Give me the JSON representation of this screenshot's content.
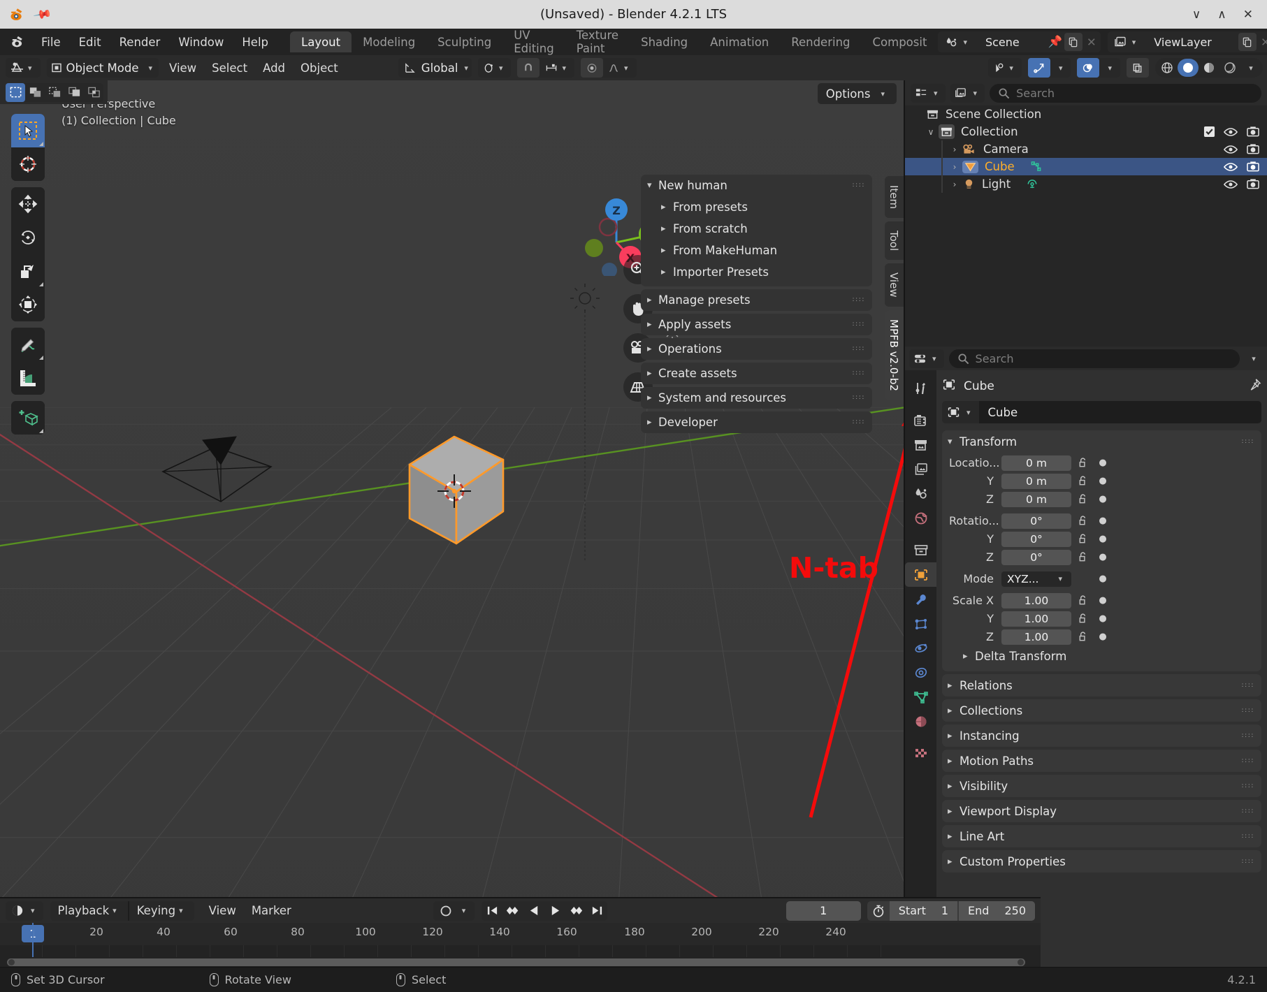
{
  "window": {
    "title": "(Unsaved) - Blender 4.2.1 LTS",
    "minimize": "∨",
    "maximize": "∧",
    "close": "✕"
  },
  "menubar": {
    "items": [
      "File",
      "Edit",
      "Render",
      "Window",
      "Help"
    ],
    "workspace_tabs": [
      {
        "label": "Layout",
        "active": true
      },
      {
        "label": "Modeling",
        "active": false
      },
      {
        "label": "Sculpting",
        "active": false
      },
      {
        "label": "UV Editing",
        "active": false
      },
      {
        "label": "Texture Paint",
        "active": false
      },
      {
        "label": "Shading",
        "active": false
      },
      {
        "label": "Animation",
        "active": false
      },
      {
        "label": "Rendering",
        "active": false
      },
      {
        "label": "Composit",
        "active": false
      }
    ],
    "scene_name": "Scene",
    "viewlayer_name": "ViewLayer"
  },
  "viewport_header": {
    "mode": "Object Mode",
    "menus": [
      "View",
      "Select",
      "Add",
      "Object"
    ],
    "transform_orientation": "Global",
    "options_label": "Options"
  },
  "viewport": {
    "perspective": "User Perspective",
    "scene_info": "(1) Collection | Cube",
    "gizmo_axes": [
      {
        "label": "Z",
        "color": "#3889d8"
      },
      {
        "label": "Y",
        "color": "#7ac01d"
      },
      {
        "label": "X",
        "color": "#fa3d5d"
      }
    ],
    "annotation": {
      "text": "N-tab",
      "color": "#f40b0b"
    },
    "toolbar_icons": [
      "tweak-select-tool",
      "cursor-tool",
      "move-tool",
      "rotate-tool",
      "scale-tool",
      "transform-tool",
      "annotate-tool",
      "measure-tool",
      "add-cube-tool"
    ],
    "nav_icons": [
      "zoom-icon",
      "hand-icon",
      "camera-icon",
      "grid-icon"
    ]
  },
  "npanel": {
    "tabs": [
      {
        "label": "Item",
        "active": false
      },
      {
        "label": "Tool",
        "active": false
      },
      {
        "label": "View",
        "active": false
      },
      {
        "label": "MPFB v2.0-b2",
        "active": true
      }
    ],
    "sections": [
      {
        "label": "New human",
        "expanded": true,
        "children": [
          "From presets",
          "From scratch",
          "From MakeHuman",
          "Importer Presets"
        ]
      },
      {
        "label": "Manage presets",
        "expanded": false,
        "children": []
      },
      {
        "label": "Apply assets",
        "expanded": false,
        "children": []
      },
      {
        "label": "Operations",
        "expanded": false,
        "children": []
      },
      {
        "label": "Create assets",
        "expanded": false,
        "children": []
      },
      {
        "label": "System and resources",
        "expanded": false,
        "children": []
      },
      {
        "label": "Developer",
        "expanded": false,
        "children": []
      }
    ]
  },
  "outliner": {
    "search_placeholder": "Search",
    "rows": [
      {
        "label": "Scene Collection",
        "indent": 0,
        "icon": "collection-icon",
        "expander": "",
        "selected": false,
        "checkbox": false,
        "eye": false,
        "camera": false
      },
      {
        "label": "Collection",
        "indent": 1,
        "icon": "collection-icon",
        "expander": "∨",
        "selected": false,
        "checkbox": true,
        "eye": true,
        "camera": true
      },
      {
        "label": "Camera",
        "indent": 2,
        "icon": "camera-object-icon",
        "expander": "›",
        "selected": false,
        "checkbox": false,
        "eye": true,
        "camera": true
      },
      {
        "label": "Cube",
        "indent": 2,
        "icon": "mesh-object-icon",
        "expander": "›",
        "selected": true,
        "checkbox": false,
        "eye": true,
        "camera": true,
        "data_icon": "mesh-data-icon"
      },
      {
        "label": "Light",
        "indent": 2,
        "icon": "light-object-icon",
        "expander": "›",
        "selected": false,
        "checkbox": false,
        "eye": true,
        "camera": true,
        "data_icon": "light-data-icon"
      }
    ]
  },
  "properties": {
    "search_placeholder": "Search",
    "breadcrumb_object": "Cube",
    "object_name": "Cube",
    "tabs": [
      "tool-icon",
      "render-icon",
      "output-icon",
      "viewlayer-icon",
      "scene-icon",
      "world-icon",
      "collection-icon",
      "object-icon",
      "modifiers-icon",
      "particles-icon",
      "physics-icon",
      "constraints-icon",
      "data-icon",
      "material-icon",
      "texture-icon"
    ],
    "transform": {
      "title": "Transform",
      "location": {
        "label": "Locatio...",
        "x": "0 m",
        "y_label": "Y",
        "y": "0 m",
        "z_label": "Z",
        "z": "0 m"
      },
      "rotation": {
        "label": "Rotatio...",
        "x": "0°",
        "y_label": "Y",
        "y": "0°",
        "z_label": "Z",
        "z": "0°"
      },
      "mode": {
        "label": "Mode",
        "value": "XYZ..."
      },
      "scale": {
        "label": "Scale X",
        "x": "1.00",
        "y_label": "Y",
        "y": "1.00",
        "z_label": "Z",
        "z": "1.00"
      },
      "delta": "Delta Transform"
    },
    "panels": [
      "Relations",
      "Collections",
      "Instancing",
      "Motion Paths",
      "Visibility",
      "Viewport Display",
      "Line Art",
      "Custom Properties"
    ]
  },
  "timeline": {
    "menus": [
      "Playback",
      "Keying",
      "View",
      "Marker"
    ],
    "current_frame": "1",
    "start_label": "Start",
    "start_value": "1",
    "end_label": "End",
    "end_value": "250",
    "ticks": [
      "20",
      "40",
      "60",
      "80",
      "100",
      "120",
      "140",
      "160",
      "180",
      "200",
      "220",
      "240"
    ],
    "playhead_label": "1"
  },
  "statusbar": {
    "items": [
      "Set 3D Cursor",
      "Rotate View",
      "Select"
    ],
    "version": "4.2.1"
  }
}
